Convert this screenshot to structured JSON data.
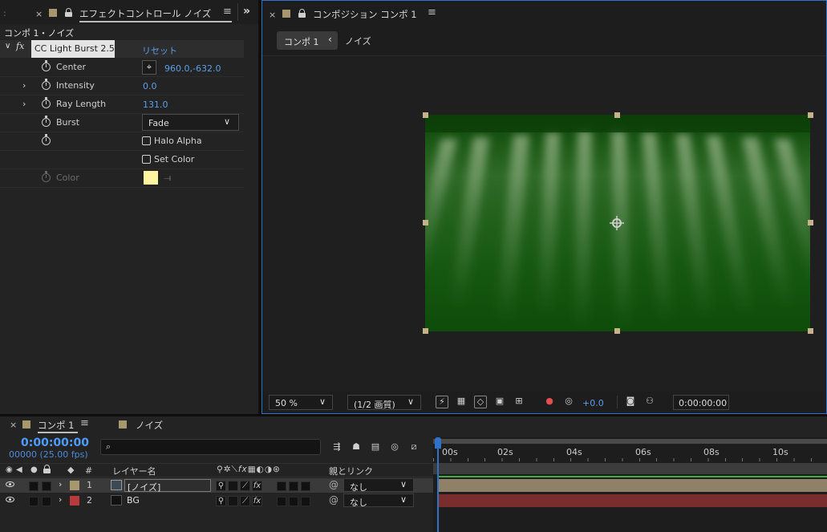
{
  "effect_panel": {
    "tab_title": "エフェクトコントロール ノイズ",
    "comp_path": "コンポ 1・ノイズ",
    "fx_badge": "fx",
    "effect_name": "CC Light Burst 2.5",
    "reset_label": "リセット",
    "expand_icon": "double-chevron-right-icon",
    "properties": [
      {
        "label": "Center",
        "value": "960.0,-632.0",
        "has_crosshair": true
      },
      {
        "label": "Intensity",
        "value": "0.0",
        "expandable": true
      },
      {
        "label": "Ray Length",
        "value": "131.0",
        "expandable": true
      },
      {
        "label": "Burst",
        "dropdown": "Fade"
      },
      {
        "label": "",
        "checkbox": "Halo Alpha",
        "checked": false
      },
      {
        "label": "",
        "checkbox": "Set Color",
        "checked": false
      },
      {
        "label": "Color",
        "color_swatch": "#fff5a0",
        "disabled": true
      }
    ]
  },
  "comp_panel": {
    "tab_title": "コンポジション コンポ 1",
    "breadcrumb_active": "コンポ 1",
    "breadcrumb_next": "ノイズ",
    "zoom": "50 %",
    "resolution": "(1/2 画質)",
    "exposure": "+0.0",
    "timecode": "0:00:00:00",
    "frame_color_top": "#0b4a08",
    "frame_color_bottom": "#0e4d0a"
  },
  "timeline": {
    "tab_active": "コンポ 1",
    "tab_other": "ノイズ",
    "timecode": "0:00:00:00",
    "frames": "00000 (25.00 fps)",
    "search_placeholder": "",
    "column_num": "#",
    "column_layer_name": "レイヤー名",
    "column_parent": "親とリンク",
    "ruler": [
      "00s",
      "02s",
      "04s",
      "06s",
      "08s",
      "10s"
    ],
    "layers": [
      {
        "num": "1",
        "name": "[ノイズ]",
        "parent": "なし",
        "label_color": "#a8966e",
        "bar_color": "#8f8068"
      },
      {
        "num": "2",
        "name": "BG",
        "parent": "なし",
        "label_color": "#b83a3a",
        "bar_color": "#7a2d2d"
      }
    ]
  },
  "accent_color": "#2f73c6"
}
